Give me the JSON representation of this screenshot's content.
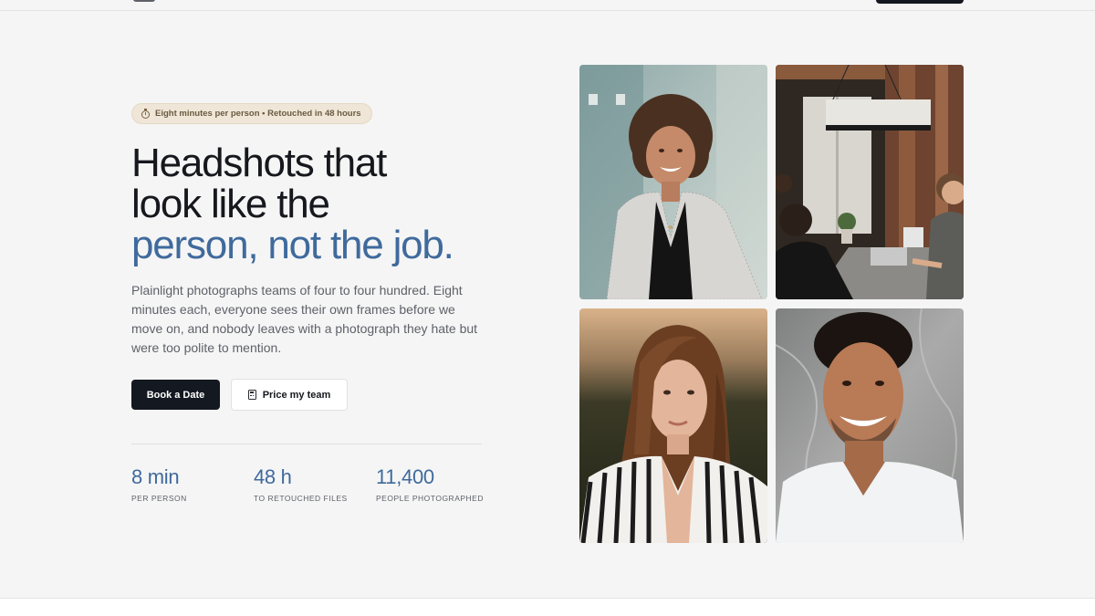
{
  "hero": {
    "pill_text": "Eight minutes per person • Retouched in 48 hours",
    "headline_line1": "Headshots that",
    "headline_line2": "look like the",
    "headline_accent": "person, not the job.",
    "lede": "Plainlight photographs teams of four to four hundred. Eight minutes each, everyone sees their own frames before we move on, and nobody leaves with a photograph they hate but were too polite to mention.",
    "primary_button": "Book a Date",
    "secondary_button": "Price my team",
    "stats": [
      {
        "value": "8 min",
        "label": "PER PERSON"
      },
      {
        "value": "48 h",
        "label": "TO RETOUCHED FILES"
      },
      {
        "value": "11,400",
        "label": "PEOPLE PHOTOGRAPHED"
      }
    ]
  },
  "icons": {
    "pill_icon": "stopwatch-icon",
    "secondary_button_icon": "calculator-icon"
  },
  "colors": {
    "background": "#f5f5f5",
    "ink": "#16181d",
    "accent": "#3f6a9c",
    "primary_button": "#141820",
    "pill_background": "#efe6d8"
  }
}
